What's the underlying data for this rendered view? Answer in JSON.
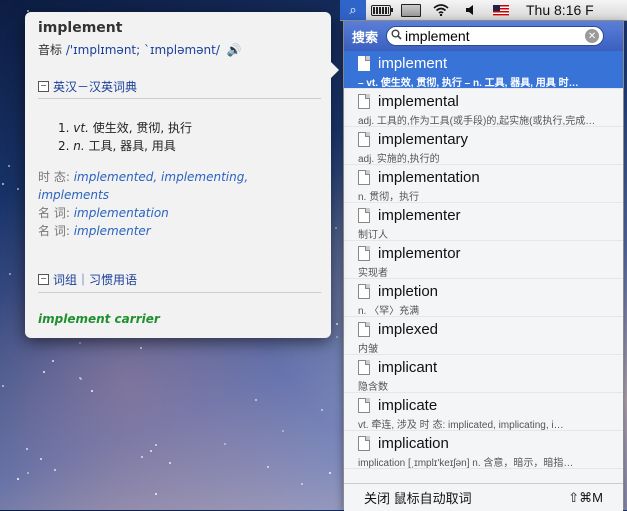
{
  "menubar": {
    "spotlight_icon": "⌕",
    "clock": "Thu 8:16 F"
  },
  "spotlight": {
    "label": "搜索",
    "query": "implement",
    "results": [
      {
        "word": "implement",
        "def": "– vt. 使生效, 贯彻, 执行 – n. 工具, 器具, 用具 时…",
        "selected": true
      },
      {
        "word": "implemental",
        "def": "adj. 工具的,作为工具(或手段)的,起实施(或执行,完成…",
        "selected": false
      },
      {
        "word": "implementary",
        "def": "adj. 实施的,执行的",
        "selected": false
      },
      {
        "word": "implementation",
        "def": "n. 贯彻，执行",
        "selected": false
      },
      {
        "word": "implementer",
        "def": "制订人",
        "selected": false
      },
      {
        "word": "implementor",
        "def": "实现者",
        "selected": false
      },
      {
        "word": "impletion",
        "def": "n. 〈罕〉充满",
        "selected": false
      },
      {
        "word": "implexed",
        "def": "内皱",
        "selected": false
      },
      {
        "word": "implicant",
        "def": "隐含数",
        "selected": false
      },
      {
        "word": "implicate",
        "def": "vt. 牵连, 涉及  时 态:   implicated, implicating, i…",
        "selected": false
      },
      {
        "word": "implication",
        "def": "implication    [ˌɪmplɪ'keɪʃən] n. 含意，暗示，暗指…",
        "selected": false
      }
    ],
    "footer_left": "关闭 鼠标自动取词",
    "footer_right": "⇧⌘M"
  },
  "popover": {
    "headword": "implement",
    "phonetic_label": "音标",
    "phonetic": "/'ɪmplɪmənt; `ɪmpləmənt/",
    "section_title": "英汉－汉英词典",
    "senses": [
      {
        "num": "1.",
        "pos": "vt.",
        "text": "使生效, 贯彻, 执行"
      },
      {
        "num": "2.",
        "pos": "n.",
        "text": "工具, 器具, 用具"
      }
    ],
    "forms": {
      "tense_label": "时 态:",
      "tense_value": "implemented, implementing, implements",
      "noun1_label": "名 词:",
      "noun1_value": "implementation",
      "noun2_label": "名 词:",
      "noun2_value": "implementer"
    },
    "section2_title": "词组｜习惯用语",
    "phrase": "implement carrier"
  }
}
